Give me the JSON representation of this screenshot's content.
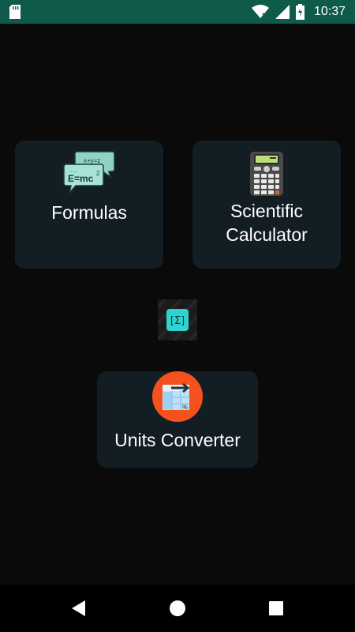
{
  "status_bar": {
    "time": "10:37",
    "icons": [
      "sd-card-icon",
      "wifi-icon",
      "signal-icon",
      "battery-icon"
    ],
    "color": "#0f5b4b"
  },
  "cards": {
    "formulas": {
      "label": "Formulas",
      "icon": "formula-chat-icon"
    },
    "calculator": {
      "label": "Scientific Calculator",
      "icon": "calculator-icon"
    },
    "units": {
      "label": "Units Converter",
      "icon": "units-converter-icon"
    }
  },
  "center_logo": {
    "icon": "sigma-logo-icon",
    "text": "[Σ]"
  },
  "nav_bar": {
    "buttons": [
      "back-icon",
      "home-icon",
      "recents-icon"
    ]
  },
  "colors": {
    "background": "#0a0a0a",
    "card": "#131e24",
    "accent_orange": "#f4511e",
    "accent_teal": "#2fd3cf"
  }
}
